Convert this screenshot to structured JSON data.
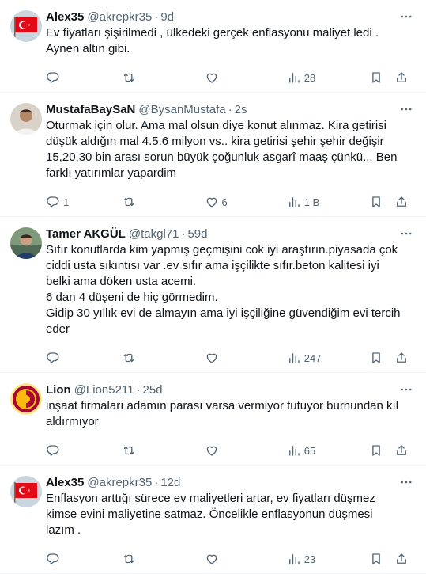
{
  "tweets": [
    {
      "name": "Alex35",
      "handle": "@akrepkr35",
      "dot": "·",
      "time": "9d",
      "lines": [
        "Ev fiyatları şişirilmedi , ülkedeki gerçek enflasyonu maliyet ledi . Aynen altın gibi."
      ],
      "replies": "",
      "retweets": "",
      "likes": "",
      "views": "28",
      "avatar": "flag"
    },
    {
      "name": "MustafaBaySaN",
      "handle": "@BysanMustafa",
      "dot": "·",
      "time": "2s",
      "lines": [
        "Oturmak için olur. Ama mal olsun diye konut alınmaz. Kira getirisi düşük aldığın mal 4.5.6 milyon vs.. kira getirisi şehir şehir değişir 15,20,30 bin arası sorun büyük çoğunluk asgarî maaş çünkü... Ben farklı yatırımlar yapardim"
      ],
      "replies": "1",
      "retweets": "",
      "likes": "6",
      "views": "1 B",
      "avatar": "person"
    },
    {
      "name": "Tamer AKGÜL",
      "handle": "@takgl71",
      "dot": "·",
      "time": "59d",
      "lines": [
        "Sıfır konutlarda kim yapmış geçmişini cok iyi araştırın.piyasada çok ciddi usta sıkıntısı var .ev sıfır ama işçilikte sıfır.beton kalitesi iyi belki ama döken usta acemi.",
        "6 dan 4 düşeni de hiç görmedim.",
        "Gidip 30 yıllık evi de almayın ama iyi işçiliğine güvendiğim evi tercih eder"
      ],
      "replies": "",
      "retweets": "",
      "likes": "",
      "views": "247",
      "avatar": "person2"
    },
    {
      "name": "Lion",
      "handle": "@Lion5211",
      "dot": "·",
      "time": "25d",
      "lines": [
        "inşaat firmaları adamın parası varsa vermiyor tutuyor burnundan kıl aldırmıyor"
      ],
      "replies": "",
      "retweets": "",
      "likes": "",
      "views": "65",
      "avatar": "gs"
    },
    {
      "name": "Alex35",
      "handle": "@akrepkr35",
      "dot": "·",
      "time": "12d",
      "lines": [
        "Enflasyon arttığı sürece ev maliyetleri artar, ev fiyatları düşmez kimse evini maliyetine satmaz. Öncelikle enflasyonun düşmesi lazım ."
      ],
      "replies": "",
      "retweets": "",
      "likes": "",
      "views": "23",
      "avatar": "flag"
    }
  ]
}
